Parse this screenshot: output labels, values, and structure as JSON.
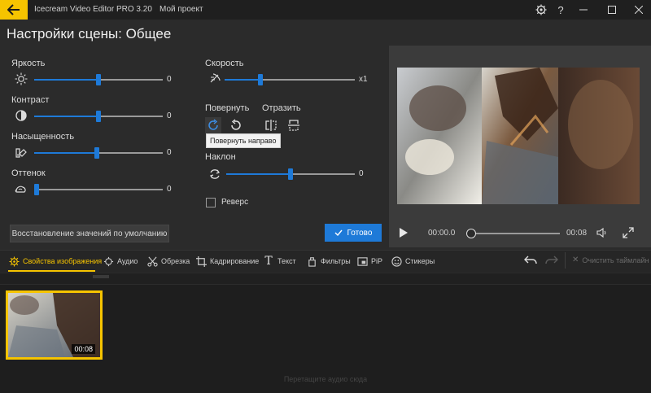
{
  "app": {
    "title": "Icecream Video Editor PRO 3.20",
    "project": "Мой проект"
  },
  "header": {
    "title": "Настройки сцены: Общее"
  },
  "adjustments": [
    {
      "label": "Яркость",
      "value": "0",
      "fraction": 0.5
    },
    {
      "label": "Контраст",
      "value": "0",
      "fraction": 0.5
    },
    {
      "label": "Насыщенность",
      "value": "0",
      "fraction": 0.5
    },
    {
      "label": "Оттенок",
      "value": "0",
      "fraction": 0.0
    }
  ],
  "speed": {
    "label": "Скорость",
    "value": "x1",
    "fraction": 0.28
  },
  "rotate": {
    "label": "Повернуть",
    "tooltip": "Повернуть направо"
  },
  "flip": {
    "label": "Отразить"
  },
  "tilt": {
    "label": "Наклон",
    "value": "0",
    "fraction": 0.5
  },
  "reverse": {
    "label": "Реверс",
    "checked": false
  },
  "buttons": {
    "reset": "Восстановление значений по умолчанию",
    "done": "Готово"
  },
  "player": {
    "current_time": "00:00.0",
    "total_time": "00:08",
    "progress": 0.0
  },
  "toolbar": {
    "tabs": [
      {
        "label": "Свойства изображения",
        "icon": "gear-icon",
        "active": true
      },
      {
        "label": "Аудио",
        "icon": "audio-icon"
      },
      {
        "label": "Обрезка",
        "icon": "scissors-icon"
      },
      {
        "label": "Кадрирование",
        "icon": "crop-icon"
      },
      {
        "label": "Текст",
        "icon": "text-icon"
      },
      {
        "label": "Фильтры",
        "icon": "filters-icon"
      },
      {
        "label": "PiP",
        "icon": "pip-icon"
      },
      {
        "label": "Стикеры",
        "icon": "sticker-icon"
      }
    ],
    "clear_timeline": "Очистить таймлайн"
  },
  "timeline": {
    "clip_duration": "00:08",
    "add_music": "Перетащите аудио сюда"
  },
  "colors": {
    "accent_yellow": "#f6c400",
    "accent_blue": "#1e7ad8",
    "background": "#2b2b2b"
  }
}
